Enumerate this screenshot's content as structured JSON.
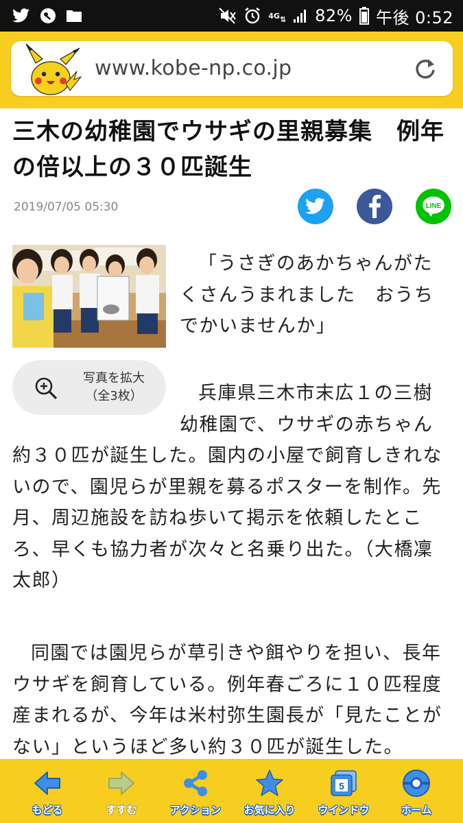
{
  "status_bar": {
    "network": "4G",
    "battery": "82%",
    "time": "午後 0:52"
  },
  "browser": {
    "url": "www.kobe-np.co.jp"
  },
  "article": {
    "title": "三木の幼稚園でウサギの里親募集　例年の倍以上の３０匹誕生",
    "date": "2019/07/05 05:30",
    "photo_button_line1": "写真を拡大",
    "photo_button_line2": "（全3枚）",
    "p1": "「うさぎのあかちゃんがたくさんうまれました　おうちでかいませんか」",
    "p2a": "兵庫県三木市末広１の三樹幼稚園で、ウサギの赤ちゃん",
    "p2b": "約３０匹が誕生した。園内の小屋で飼育しきれないので、園児らが里親を募るポスターを制作。先月、周辺施設を訪ね歩いて掲示を依頼したところ、早くも協力者が次々と名乗り出た。（大橋凜太郎）",
    "p3": "同園では園児らが草引きや餌やりを担い、長年ウサギを飼育している。例年春ごろに１０匹程度産まれるが、今年は米村弥生園長が「見たことがない」というほど多い約３０匹が誕生した。"
  },
  "share": {
    "line_label": "LINE"
  },
  "toolbar": {
    "back": "もどる",
    "forward": "すすむ",
    "action": "アクション",
    "favorites": "お気に入り",
    "window": "ウインドウ",
    "window_count": "5",
    "home": "ホーム"
  },
  "colors": {
    "brand_yellow": "#f7cd1f",
    "twitter": "#1da1f2",
    "facebook": "#3b5998",
    "line": "#00c300",
    "toolbar_blue": "#1e5db4"
  }
}
